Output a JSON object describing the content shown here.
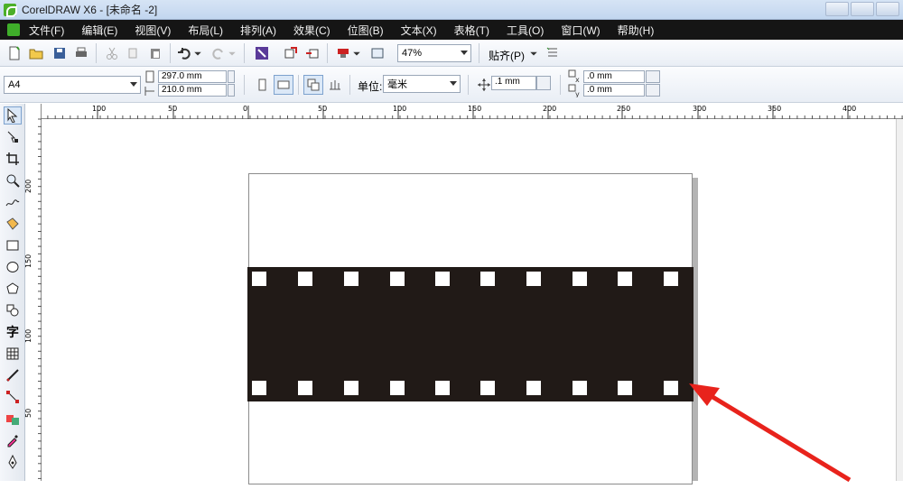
{
  "window": {
    "title": "CorelDRAW X6 - [未命名 -2]"
  },
  "menu": [
    "文件(F)",
    "编辑(E)",
    "视图(V)",
    "布局(L)",
    "排列(A)",
    "效果(C)",
    "位图(B)",
    "文本(X)",
    "表格(T)",
    "工具(O)",
    "窗口(W)",
    "帮助(H)"
  ],
  "standard_toolbar": {
    "zoom": "47%",
    "snap": "贴齐(P)"
  },
  "property_bar": {
    "paper_size": "A4",
    "width": "297.0 mm",
    "height": "210.0 mm",
    "units_label": "单位:",
    "units": "毫米",
    "nudge": ".1 mm",
    "dup_x": ".0 mm",
    "dup_y": ".0 mm"
  },
  "hruler_labels": [
    "100",
    "50",
    "0",
    "50",
    "100",
    "150",
    "200",
    "250",
    "300",
    "350",
    "400"
  ],
  "vruler_labels": [
    "200",
    "150",
    "100",
    "50"
  ],
  "toolbox": {
    "text_tool_label": "字"
  },
  "colors": {
    "film_strip": "#211a17",
    "arrow": "#e8231c",
    "menubar": "#151515"
  },
  "icons": [
    "select-icon",
    "shape-icon",
    "crop-icon",
    "zoom-icon",
    "freehand-icon",
    "smart-fill-icon",
    "rectangle-icon",
    "ellipse-icon",
    "polygon-icon",
    "basic-shapes-icon",
    "text-icon",
    "table-icon",
    "dimension-icon",
    "connector-icon",
    "interactive-icon",
    "eyedropper-icon",
    "outline-pen-icon"
  ]
}
